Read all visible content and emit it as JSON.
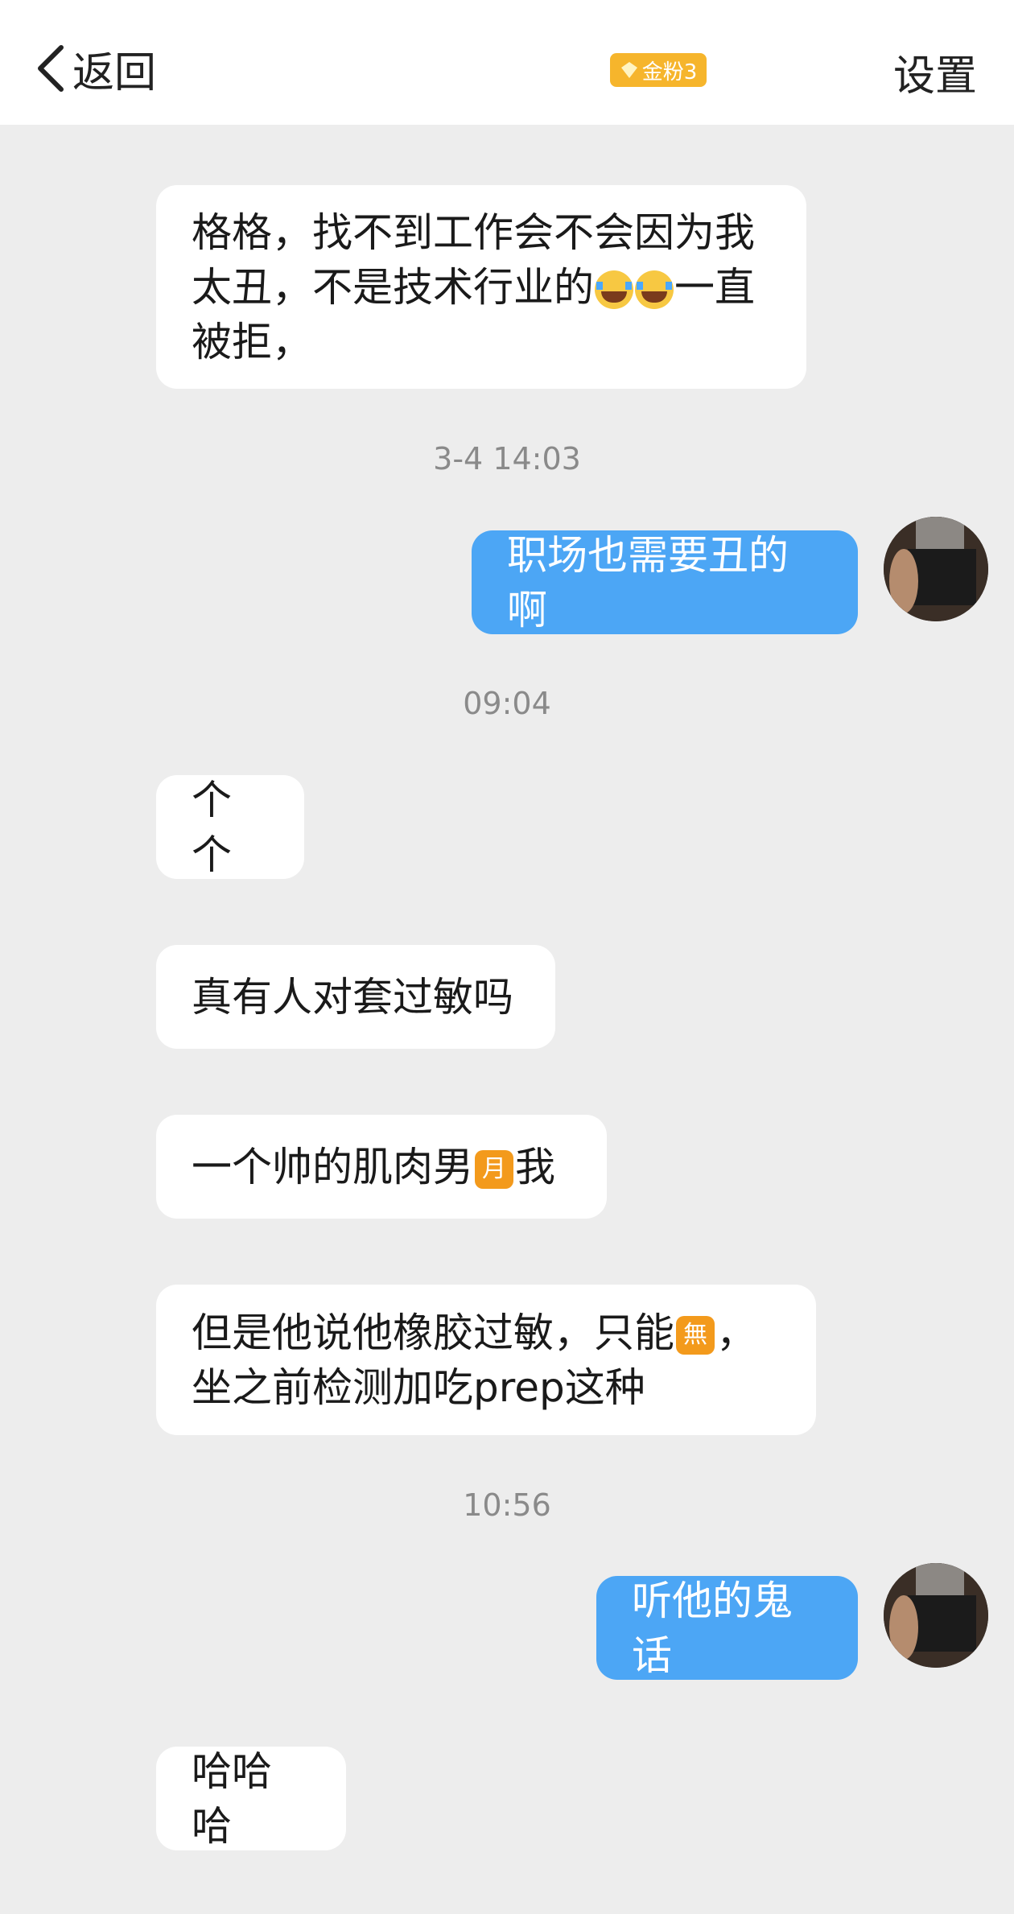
{
  "header": {
    "back_label": "返回",
    "badge_label": "金粉3",
    "settings_label": "设置"
  },
  "messages": [
    {
      "side": "left",
      "line1": "格格，找不到工作会不会因为我",
      "line2_pre": "太丑，不是技术行业的",
      "line2_post": "一直",
      "line3": "被拒，",
      "emoji": "crying-face"
    },
    {
      "time": "3-4 14:03"
    },
    {
      "side": "right",
      "text": "职场也需要丑的啊"
    },
    {
      "time": "09:04"
    },
    {
      "side": "left",
      "text": "个个"
    },
    {
      "side": "left",
      "text": "真有人对套过敏吗"
    },
    {
      "side": "left",
      "text_pre": "一个帅的肌肉男",
      "emoji_char": "月",
      "text_post": "我"
    },
    {
      "side": "left",
      "line1_pre": "但是他说他橡胶过敏，只能",
      "emoji_char": "無",
      "line1_post": "，",
      "line2": "坐之前检测加吃prep这种"
    },
    {
      "time": "10:56"
    },
    {
      "side": "right",
      "text": "听他的鬼话"
    },
    {
      "side": "left",
      "text": "哈哈哈"
    }
  ],
  "colors": {
    "background": "#ededed",
    "left_bubble": "#ffffff",
    "right_bubble": "#4ca6f5",
    "badge": "#f6b52c"
  }
}
